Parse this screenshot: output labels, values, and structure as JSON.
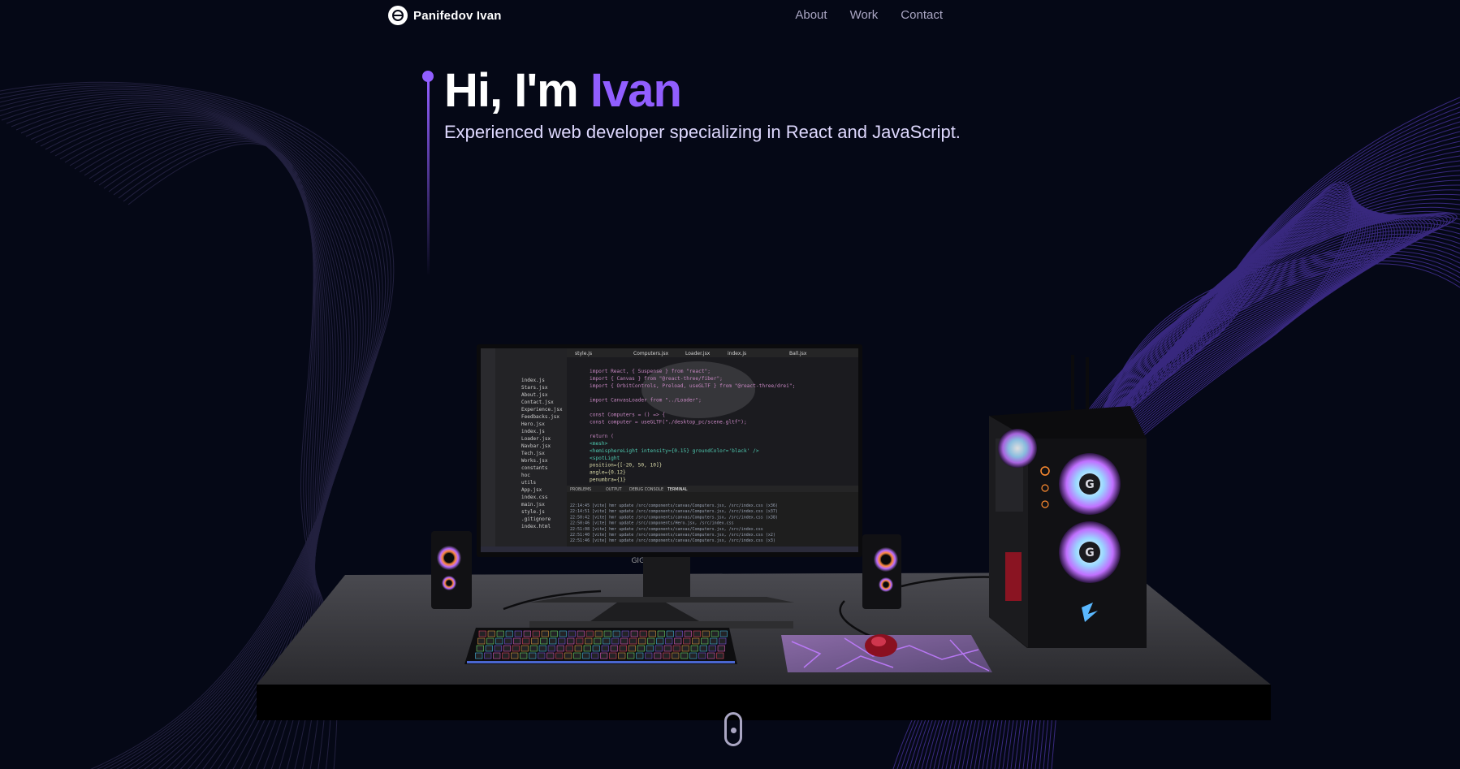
{
  "nav": {
    "brand": "Panifedov Ivan",
    "links": [
      "About",
      "Work",
      "Contact"
    ]
  },
  "hero": {
    "greeting": "Hi, I'm ",
    "name": "Ivan",
    "subtitle": "Experienced web developer specializing in React and JavaScript."
  },
  "scene": {
    "monitor_brand": "GIGABYTE",
    "editor_tabs": [
      "style.js",
      "Computers.jsx",
      "Loader.jsx",
      "index.js",
      "Ball.jsx"
    ],
    "editor_code": [
      "import React, { Suspense } from \"react\";",
      "import { Canvas } from \"@react-three/fiber\";",
      "import { OrbitControls, Preload, useGLTF } from \"@react-three/drei\";",
      "",
      "import CanvasLoader from \"../Loader\";",
      "",
      "const Computers = () => {",
      "  const computer = useGLTF(\"./desktop_pc/scene.gltf\");",
      "",
      "  return (",
      "    <mesh>",
      "      <hemisphereLight intensity={0.15} groundColor='black' />",
      "      <spotLight",
      "        position={[-20, 50, 10]}",
      "        angle={0.12}",
      "        penumbra={1}"
    ],
    "terminal_lines": [
      "22:14:45 [vite] hmr update /src/components/canvas/Computers.jsx, /src/index.css (x36)",
      "22:14:51 [vite] hmr update /src/components/canvas/Computers.jsx, /src/index.css (x37)",
      "22:50:42 [vite] hmr update /src/components/canvas/Computers.jsx, /src/index.css (x38)",
      "22:50:46 [vite] hmr update /src/components/Hero.jsx, /src/index.css",
      "22:51:08 [vite] hmr update /src/components/canvas/Computers.jsx, /src/index.css",
      "22:51:40 [vite] hmr update /src/components/canvas/Computers.jsx, /src/index.css (x2)",
      "22:51:46 [vite] hmr update /src/components/canvas/Computers.jsx, /src/index.css (x3)"
    ],
    "explorer_files": [
      "index.js",
      "Stars.jsx",
      "About.jsx",
      "Contact.jsx",
      "Experience.jsx",
      "Feedbacks.jsx",
      "Hero.jsx",
      "index.js",
      "Loader.jsx",
      "Navbar.jsx",
      "Tech.jsx",
      "Works.jsx",
      "constants",
      "hoc",
      "utils",
      "App.jsx",
      "index.css",
      "main.jsx",
      "style.js",
      ".gitignore",
      "index.html"
    ],
    "accent_colors": {
      "purple": "#915eff",
      "background": "#050816",
      "muted_text": "#aaa6c3"
    }
  }
}
